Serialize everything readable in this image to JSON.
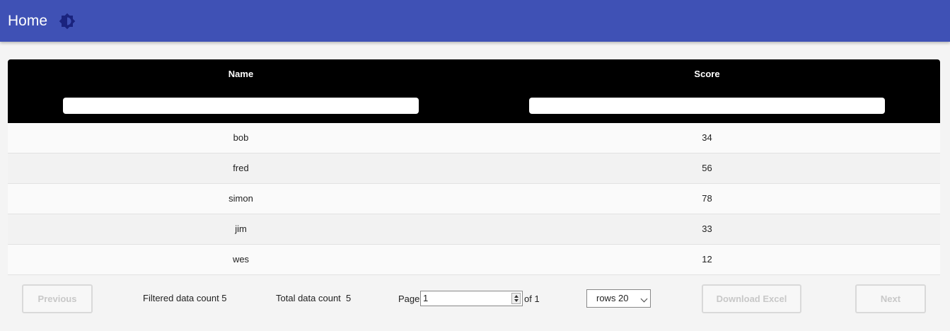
{
  "appbar": {
    "title": "Home",
    "theme_icon": "theme-toggle-icon",
    "color": "#3f51b5"
  },
  "table": {
    "columns": [
      {
        "label": "Name",
        "filter_value": ""
      },
      {
        "label": "Score",
        "filter_value": ""
      }
    ],
    "rows": [
      {
        "name": "bob",
        "score": "34"
      },
      {
        "name": "fred",
        "score": "56"
      },
      {
        "name": "simon",
        "score": "78"
      },
      {
        "name": "jim",
        "score": "33"
      },
      {
        "name": "wes",
        "score": "12"
      }
    ]
  },
  "footer": {
    "previous_label": "Previous",
    "filtered_count_text": "Filtered data count 5",
    "total_count_text": "Total data count  5",
    "page_label": "Page",
    "page_value": "1",
    "of_text": "of 1",
    "rows_select": "rows 20",
    "download_label": "Download Excel",
    "next_label": "Next"
  }
}
